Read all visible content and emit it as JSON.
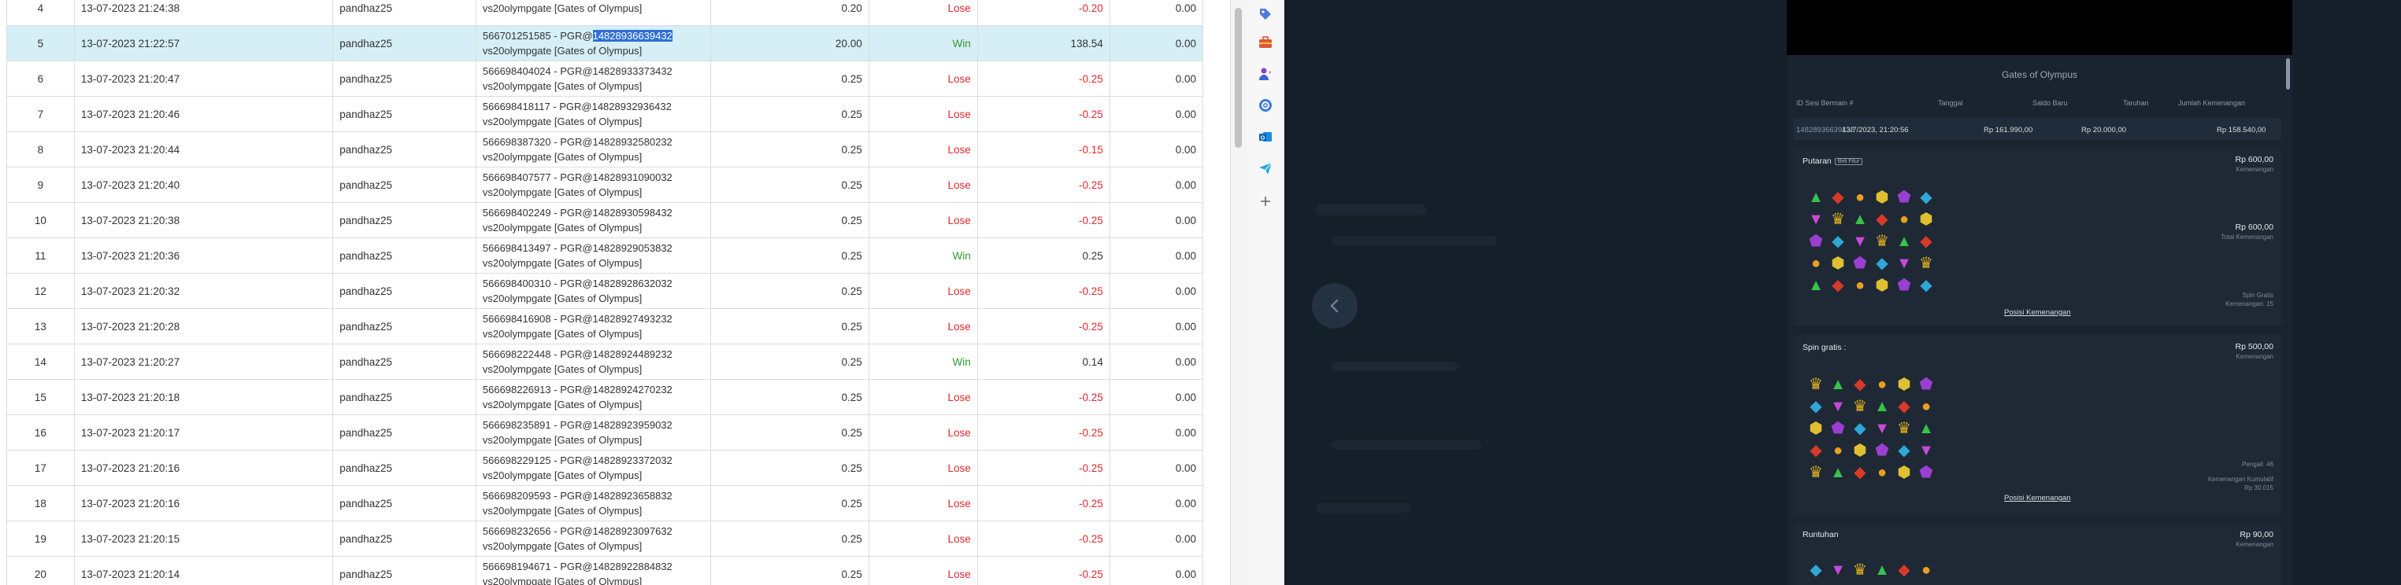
{
  "bets": [
    {
      "no": "4",
      "date": "13-07-2023 21:24:38",
      "user": "pandhaz25",
      "bet_id": "",
      "game": "vs20olympgate [Gates of Olympus]",
      "stake": "0.20",
      "result": "Lose",
      "winloss": "-0.20",
      "balance": "0.00",
      "selected": false
    },
    {
      "no": "5",
      "date": "13-07-2023 21:22:57",
      "user": "pandhaz25",
      "bet_id_prefix": "566701251585 - PGR@",
      "bet_id_highlight": "14828936639432",
      "game": "vs20olympgate [Gates of Olympus]",
      "stake": "20.00",
      "result": "Win",
      "winloss": "138.54",
      "balance": "0.00",
      "selected": true
    },
    {
      "no": "6",
      "date": "13-07-2023 21:20:47",
      "user": "pandhaz25",
      "bet_id": "566698404024 - PGR@14828933373432",
      "game": "vs20olympgate [Gates of Olympus]",
      "stake": "0.25",
      "result": "Lose",
      "winloss": "-0.25",
      "balance": "0.00",
      "selected": false
    },
    {
      "no": "7",
      "date": "13-07-2023 21:20:46",
      "user": "pandhaz25",
      "bet_id": "566698418117 - PGR@14828932936432",
      "game": "vs20olympgate [Gates of Olympus]",
      "stake": "0.25",
      "result": "Lose",
      "winloss": "-0.25",
      "balance": "0.00",
      "selected": false
    },
    {
      "no": "8",
      "date": "13-07-2023 21:20:44",
      "user": "pandhaz25",
      "bet_id": "566698387320 - PGR@14828932580232",
      "game": "vs20olympgate [Gates of Olympus]",
      "stake": "0.25",
      "result": "Lose",
      "winloss": "-0.15",
      "balance": "0.00",
      "selected": false
    },
    {
      "no": "9",
      "date": "13-07-2023 21:20:40",
      "user": "pandhaz25",
      "bet_id": "566698407577 - PGR@14828931090032",
      "game": "vs20olympgate [Gates of Olympus]",
      "stake": "0.25",
      "result": "Lose",
      "winloss": "-0.25",
      "balance": "0.00",
      "selected": false
    },
    {
      "no": "10",
      "date": "13-07-2023 21:20:38",
      "user": "pandhaz25",
      "bet_id": "566698402249 - PGR@14828930598432",
      "game": "vs20olympgate [Gates of Olympus]",
      "stake": "0.25",
      "result": "Lose",
      "winloss": "-0.25",
      "balance": "0.00",
      "selected": false
    },
    {
      "no": "11",
      "date": "13-07-2023 21:20:36",
      "user": "pandhaz25",
      "bet_id": "566698413497 - PGR@14828929053832",
      "game": "vs20olympgate [Gates of Olympus]",
      "stake": "0.25",
      "result": "Win",
      "winloss": "0.25",
      "balance": "0.00",
      "selected": false
    },
    {
      "no": "12",
      "date": "13-07-2023 21:20:32",
      "user": "pandhaz25",
      "bet_id": "566698400310 - PGR@14828928632032",
      "game": "vs20olympgate [Gates of Olympus]",
      "stake": "0.25",
      "result": "Lose",
      "winloss": "-0.25",
      "balance": "0.00",
      "selected": false
    },
    {
      "no": "13",
      "date": "13-07-2023 21:20:28",
      "user": "pandhaz25",
      "bet_id": "566698416908 - PGR@14828927493232",
      "game": "vs20olympgate [Gates of Olympus]",
      "stake": "0.25",
      "result": "Lose",
      "winloss": "-0.25",
      "balance": "0.00",
      "selected": false
    },
    {
      "no": "14",
      "date": "13-07-2023 21:20:27",
      "user": "pandhaz25",
      "bet_id": "566698222448 - PGR@14828924489232",
      "game": "vs20olympgate [Gates of Olympus]",
      "stake": "0.25",
      "result": "Win",
      "winloss": "0.14",
      "balance": "0.00",
      "selected": false
    },
    {
      "no": "15",
      "date": "13-07-2023 21:20:18",
      "user": "pandhaz25",
      "bet_id": "566698226913 - PGR@14828924270232",
      "game": "vs20olympgate [Gates of Olympus]",
      "stake": "0.25",
      "result": "Lose",
      "winloss": "-0.25",
      "balance": "0.00",
      "selected": false
    },
    {
      "no": "16",
      "date": "13-07-2023 21:20:17",
      "user": "pandhaz25",
      "bet_id": "566698235891 - PGR@14828923959032",
      "game": "vs20olympgate [Gates of Olympus]",
      "stake": "0.25",
      "result": "Lose",
      "winloss": "-0.25",
      "balance": "0.00",
      "selected": false
    },
    {
      "no": "17",
      "date": "13-07-2023 21:20:16",
      "user": "pandhaz25",
      "bet_id": "566698229125 - PGR@14828923372032",
      "game": "vs20olympgate [Gates of Olympus]",
      "stake": "0.25",
      "result": "Lose",
      "winloss": "-0.25",
      "balance": "0.00",
      "selected": false
    },
    {
      "no": "18",
      "date": "13-07-2023 21:20:16",
      "user": "pandhaz25",
      "bet_id": "566698209593 - PGR@14828923658832",
      "game": "vs20olympgate [Gates of Olympus]",
      "stake": "0.25",
      "result": "Lose",
      "winloss": "-0.25",
      "balance": "0.00",
      "selected": false
    },
    {
      "no": "19",
      "date": "13-07-2023 21:20:15",
      "user": "pandhaz25",
      "bet_id": "566698232656 - PGR@14828923097632",
      "game": "vs20olympgate [Gates of Olympus]",
      "stake": "0.25",
      "result": "Lose",
      "winloss": "-0.25",
      "balance": "0.00",
      "selected": false
    },
    {
      "no": "20",
      "date": "13-07-2023 21:20:14",
      "user": "pandhaz25",
      "bet_id": "566698194671 - PGR@14828922884832",
      "game": "vs20olympgate [Gates of Olympus]",
      "stake": "0.25",
      "result": "Lose",
      "winloss": "-0.25",
      "balance": "0.00",
      "selected": false
    }
  ],
  "colors": {
    "lose": "#e0282e",
    "win": "#2e9a2e",
    "selected_row": "#d6eef6",
    "highlight": "#2f6fd6",
    "dark_bg": "#151f2a",
    "panel_bg": "#1a2430"
  },
  "sidebar_icons": [
    "tag-icon",
    "toolbox-icon",
    "user-chess-icon",
    "gear-circle-icon",
    "outlook-icon",
    "send-icon",
    "plus-icon"
  ],
  "history": {
    "title": "Gates of Olympus",
    "headers": {
      "round_id": "ID Sesi Bermain #",
      "date": "Tanggal",
      "new_balance": "Saldo Baru",
      "bet": "Taruhan",
      "win_total": "Jumlah Kemenangan"
    },
    "summary": {
      "round_id": "14828936639432",
      "date": "13/7/2023, 21:20:56",
      "new_balance": "Rp 161.990,00",
      "bet": "Rp 20.000,00",
      "win_total": "Rp 158.540,00"
    },
    "spin": {
      "title": "Putaran",
      "tag": "Beli Fitur",
      "amount": "Rp 600,00",
      "amount_label": "Kemenangan",
      "amount2": "Rp 600,00",
      "amount2_label": "Total Kemenangan",
      "spin_info": "Spin Gratis",
      "spin_info2": "Kemenangan: 15",
      "link": "Posisi Kemenangan"
    },
    "free": {
      "title": "Spin gratis :",
      "amount": "Rp 500,00",
      "amount_label": "Kemenangan",
      "mult": "Pengali: 46",
      "mult2": "Kemenangan Kumulatif",
      "mult3": "Rp 30.015",
      "link": "Posisi Kemenangan"
    },
    "tumble": {
      "title": "Runtuhan",
      "amount": "Rp 90,00",
      "amount_label": "Kemenangan"
    }
  }
}
